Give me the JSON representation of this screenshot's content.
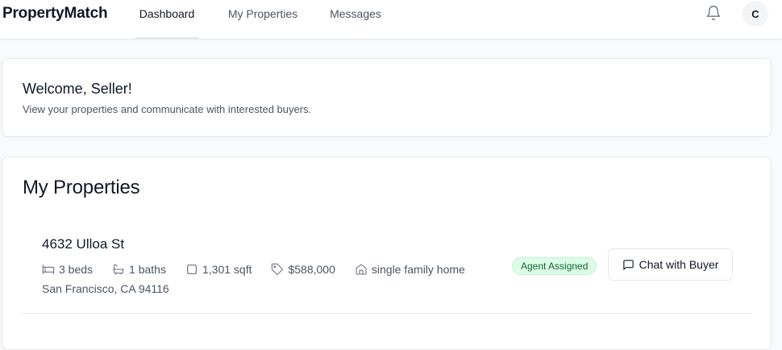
{
  "header": {
    "brand": "PropertyMatch",
    "tabs": [
      {
        "label": "Dashboard",
        "active": true
      },
      {
        "label": "My Properties",
        "active": false
      },
      {
        "label": "Messages",
        "active": false
      }
    ],
    "bell_icon": "bell-icon",
    "avatar_initial": "C"
  },
  "welcome": {
    "title": "Welcome, Seller!",
    "subtitle": "View your properties and communicate with interested buyers."
  },
  "properties": {
    "title": "My Properties",
    "items": [
      {
        "address": "4632 Ulloa St",
        "beds": "3 beds",
        "baths": "1 baths",
        "sqft": "1,301 sqft",
        "price": "$588,000",
        "type": "single family home",
        "city": "San Francisco, CA 94116",
        "status": "Agent Assigned",
        "action_label": "Chat with Buyer"
      }
    ]
  },
  "colors": {
    "badge_bg": "#dcfce7",
    "badge_text": "#166534",
    "border": "#e5e7eb"
  }
}
